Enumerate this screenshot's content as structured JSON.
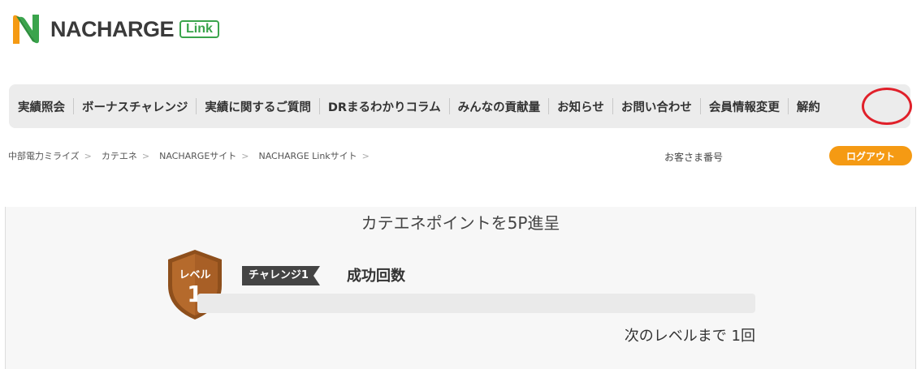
{
  "header": {
    "brand_name": "NACHARGE",
    "brand_sub": "Link",
    "brand_colors": {
      "green": "#3aa44c",
      "orange": "#f59a13"
    }
  },
  "nav": {
    "items": [
      {
        "label": "実績照会"
      },
      {
        "label": "ボーナスチャレンジ"
      },
      {
        "label": "実績に関するご質問"
      },
      {
        "label": "DRまるわかりコラム"
      },
      {
        "label": "みんなの貢献量"
      },
      {
        "label": "お知らせ"
      },
      {
        "label": "お問い合わせ"
      },
      {
        "label": "会員情報変更"
      },
      {
        "label": "解約"
      }
    ],
    "highlight_color": "#e0202a"
  },
  "breadcrumb": {
    "items": [
      {
        "label": "中部電力ミライズ"
      },
      {
        "label": "カテエネ"
      },
      {
        "label": "NACHARGEサイト"
      },
      {
        "label": "NACHARGE Linkサイト"
      }
    ],
    "separator": ">"
  },
  "account": {
    "customer_number_label": "お客さま番号",
    "logout_label": "ログアウト"
  },
  "challenge": {
    "title": "カテエネポイントを5P進呈",
    "badge_label": "レベル",
    "badge_level": "1",
    "badge_color": "#b56a2c",
    "tag_label": "チャレンジ1",
    "name": "成功回数",
    "progress_fraction": 0,
    "next_level_text": "次のレベルまで 1回"
  }
}
